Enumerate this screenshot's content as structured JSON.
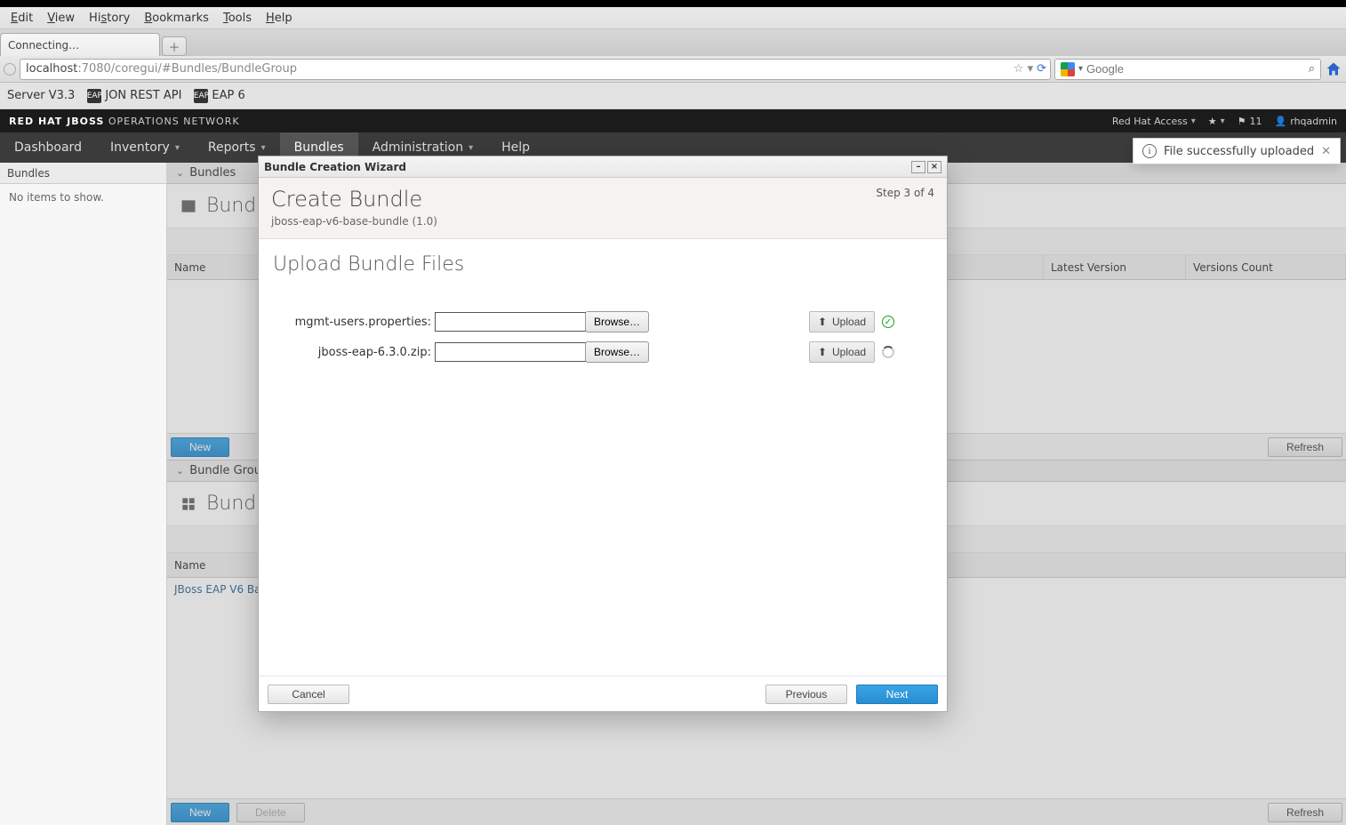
{
  "browser": {
    "menus": [
      "Edit",
      "View",
      "History",
      "Bookmarks",
      "Tools",
      "Help"
    ],
    "tab_label": "Connecting…",
    "url_host": "localhost",
    "url_path": ":7080/coregui/#Bundles/BundleGroup",
    "search_placeholder": "Google",
    "bookmarks": [
      "Server V3.3",
      "JON REST API",
      "EAP 6"
    ]
  },
  "header": {
    "brand_pre": "RED HAT JBOSS",
    "brand_post": "OPERATIONS NETWORK",
    "right": {
      "access": "Red Hat Access",
      "msg_count": "11",
      "user": "rhqadmin"
    }
  },
  "nav": [
    "Dashboard",
    "Inventory",
    "Reports",
    "Bundles",
    "Administration",
    "Help"
  ],
  "nav_active": "Bundles",
  "sidebar": {
    "section1": "Bundles",
    "body1": "No items to show."
  },
  "bundles_panel": {
    "header": "Bundles",
    "title": "Bundles",
    "cols": [
      "Name",
      "Latest Version",
      "Versions Count"
    ],
    "btn_new": "New",
    "btn_refresh": "Refresh"
  },
  "groups_panel": {
    "header": "Bundle Groups",
    "title": "Bundle Groups",
    "cols": [
      "Name"
    ],
    "row1": "JBoss EAP V6 Base",
    "btn_new": "New",
    "btn_delete": "Delete",
    "btn_refresh": "Refresh"
  },
  "modal": {
    "window_title": "Bundle Creation Wizard",
    "title": "Create Bundle",
    "subtitle": "jboss-eap-v6-base-bundle (1.0)",
    "step": "Step 3 of 4",
    "section": "Upload Bundle Files",
    "rows": [
      {
        "label": "mgmt-users.properties:",
        "browse": "Browse…",
        "upload": "Upload",
        "status": "done"
      },
      {
        "label": "jboss-eap-6.3.0.zip:",
        "browse": "Browse…",
        "upload": "Upload",
        "status": "loading"
      }
    ],
    "btn_cancel": "Cancel",
    "btn_prev": "Previous",
    "btn_next": "Next"
  },
  "toast": {
    "text": "File successfully uploaded"
  }
}
